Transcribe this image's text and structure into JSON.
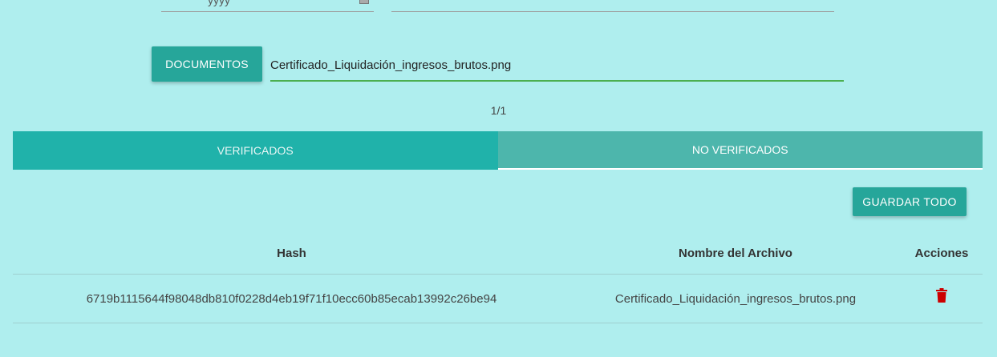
{
  "top_fields": {
    "left_clipped_text": "yyyy"
  },
  "upload": {
    "button_label": "DOCUMENTOS",
    "file_path_value": "Certificado_Liquidación_ingresos_brutos.png"
  },
  "pagination": {
    "counter": "1/1"
  },
  "tabs": [
    {
      "label": "VERIFICADOS",
      "active": false
    },
    {
      "label": "NO VERIFICADOS",
      "active": true
    }
  ],
  "toolbar": {
    "save_all_label": "GUARDAR TODO"
  },
  "table": {
    "headers": [
      "Hash",
      "Nombre del Archivo",
      "Acciones"
    ],
    "rows": [
      {
        "hash": "6719b1115644f98048db810f0228d4eb19f71f10ecc60b85ecab13992c26be94",
        "nombre": "Certificado_Liquidación_ingresos_brutos.png",
        "action_icon": "trash-icon"
      }
    ]
  },
  "colors": {
    "background": "#afeeee",
    "accent": "#26a69a",
    "tab_verificados": "#20b2aa",
    "tab_no_verificados": "#4db6ac",
    "input_focus": "#4caf50",
    "delete_icon": "#cc0000"
  }
}
